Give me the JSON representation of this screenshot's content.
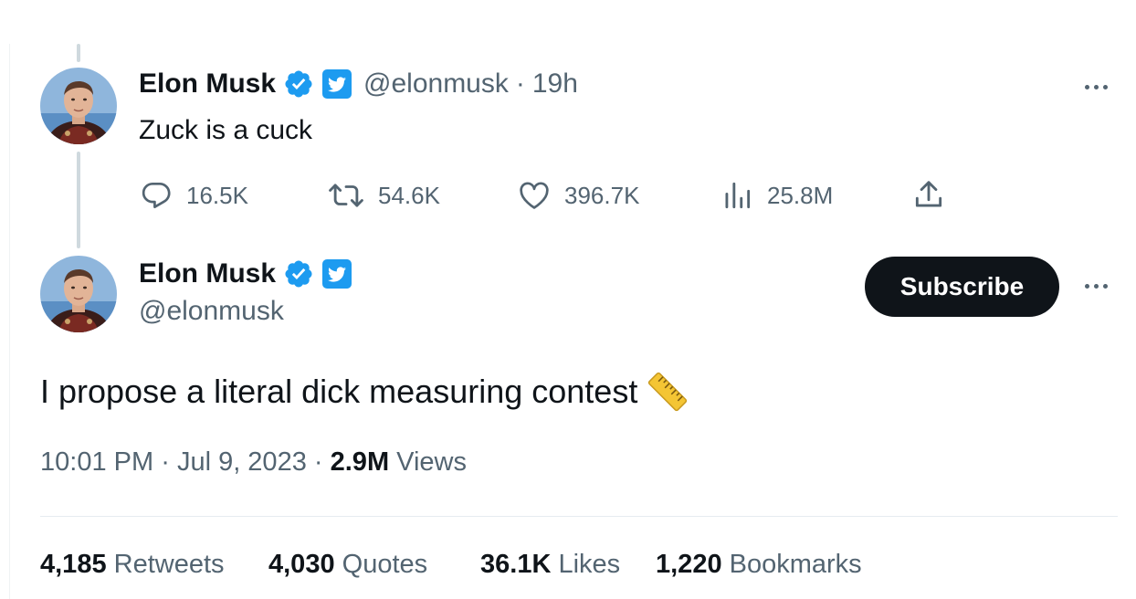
{
  "reply_tweet": {
    "author_name": "Elon Musk",
    "handle": "@elonmusk",
    "separator": "·",
    "time_ago": "19h",
    "text": "Zuck is a cuck",
    "actions": {
      "replies": "16.5K",
      "retweets": "54.6K",
      "likes": "396.7K",
      "views": "25.8M"
    },
    "icons": [
      "reply-icon",
      "retweet-icon",
      "like-icon",
      "views-icon",
      "share-icon",
      "more-icon"
    ]
  },
  "main_tweet": {
    "author_name": "Elon Musk",
    "handle": "@elonmusk",
    "subscribe_label": "Subscribe",
    "text": "I propose a literal dick measuring contest",
    "emoji": "ruler",
    "time": "10:01 PM",
    "dot": "·",
    "date": "Jul 9, 2023",
    "views_count": "2.9M",
    "views_label": "Views",
    "stats": {
      "retweets_count": "4,185",
      "retweets_label": "Retweets",
      "quotes_count": "4,030",
      "quotes_label": "Quotes",
      "likes_count": "36.1K",
      "likes_label": "Likes",
      "bookmarks_count": "1,220",
      "bookmarks_label": "Bookmarks"
    }
  },
  "colors": {
    "verified_blue": "#1d9bf0",
    "text_primary": "#0f1419",
    "text_secondary": "#536471",
    "thread_line": "#cfd9de",
    "button_bg": "#0f1419",
    "ruler_yellow": "#f4c534"
  }
}
